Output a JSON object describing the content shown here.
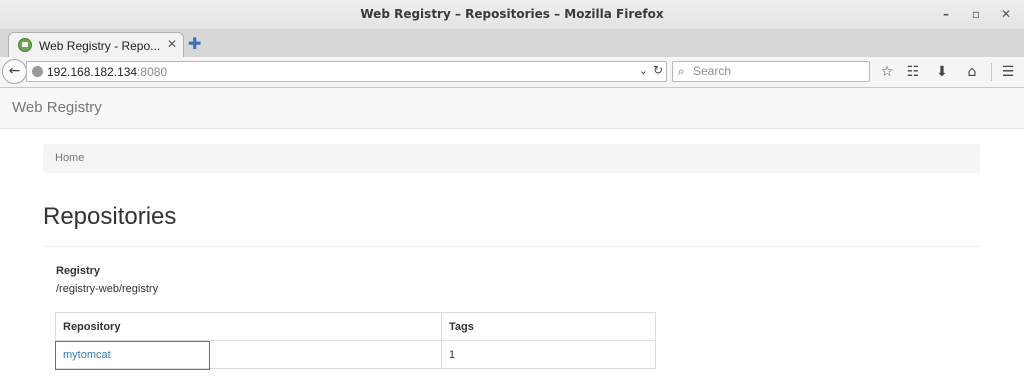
{
  "window": {
    "title": "Web Registry – Repositories – Mozilla Firefox",
    "minimize": "–",
    "maximize": "▫",
    "close": "✕"
  },
  "tab": {
    "label": "Web Registry - Repo...",
    "close": "✕",
    "new_tab": "✚"
  },
  "nav": {
    "back": "←",
    "url_host": "192.168.182.134",
    "url_port": ":8080",
    "dropdown": "⌄",
    "reload": "↻",
    "search_placeholder": "Search",
    "search_icon": "⌕"
  },
  "toolbar_icons": {
    "bookmark": "☆",
    "reading_list": "☷",
    "downloads": "⬇",
    "home": "⌂",
    "menu": "☰"
  },
  "app": {
    "brand": "Web Registry",
    "breadcrumb": "Home",
    "page_title": "Repositories",
    "registry_label": "Registry",
    "registry_path": "/registry-web/registry"
  },
  "table": {
    "headers": [
      "Repository",
      "Tags"
    ],
    "rows": [
      {
        "repository": "mytomcat",
        "tags": "1"
      }
    ]
  },
  "colors": {
    "link": "#337ab7",
    "highlight_border": "#e04040",
    "new_tab_plus": "#3b6fb6"
  }
}
